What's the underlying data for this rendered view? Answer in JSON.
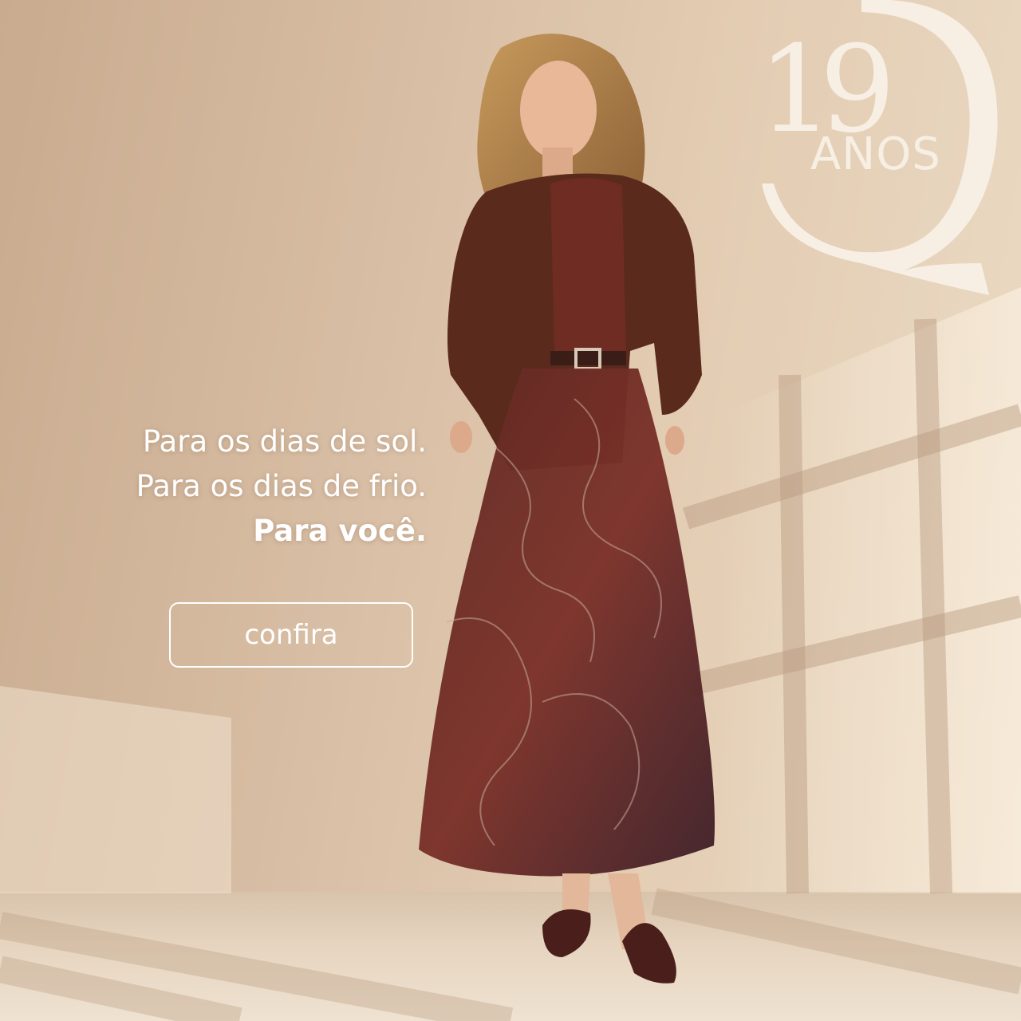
{
  "logo": {
    "number": "19",
    "word": "ANOS"
  },
  "tagline": {
    "line1": "Para os dias de sol.",
    "line2": "Para os dias de frio.",
    "line3": "Para você."
  },
  "cta": {
    "label": "confira"
  },
  "colors": {
    "text": "#ffffff",
    "logo": "#f7efe4",
    "wall": "#d7bda3",
    "outfit": "#5a2a1f"
  }
}
